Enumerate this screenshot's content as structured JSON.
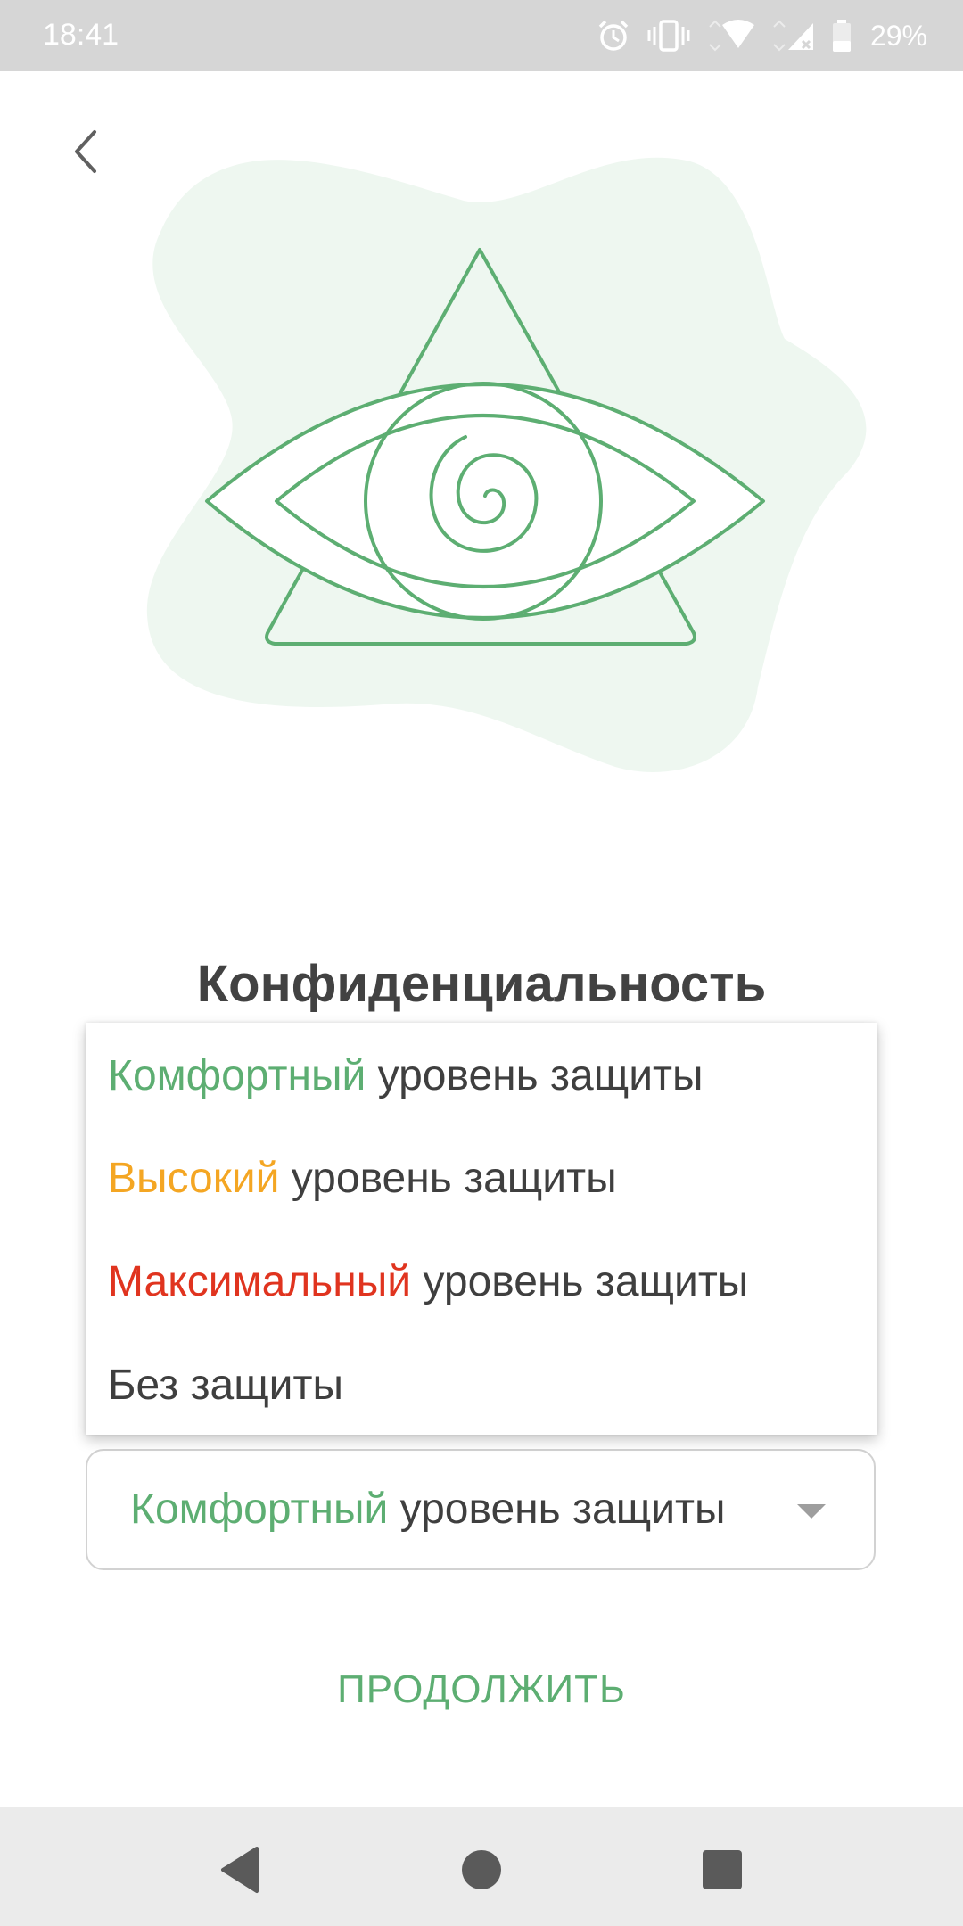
{
  "status_bar": {
    "time": "18:41",
    "battery": "29%",
    "icons": [
      "alarm-icon",
      "vibrate-icon",
      "wifi-icon",
      "cellular-icon",
      "battery-icon"
    ]
  },
  "header": {
    "back_icon": "chevron-left-icon"
  },
  "illustration": {
    "name": "eye-in-triangle-illustration"
  },
  "page": {
    "title": "Конфиденциальность"
  },
  "menu": {
    "items": [
      {
        "level": "Комфортный",
        "rest": " уровень защиты",
        "color": "#5dae72"
      },
      {
        "level": "Высокий",
        "rest": " уровень защиты",
        "color": "#f4a623"
      },
      {
        "level": "Максимальный",
        "rest": " уровень защиты",
        "color": "#e0341f"
      },
      {
        "level": "",
        "rest": "Без защиты",
        "color": "#3f3f3f"
      }
    ]
  },
  "dropdown": {
    "selected_level": "Комфортный",
    "selected_rest": " уровень защиты",
    "selected_color": "#5dae72"
  },
  "actions": {
    "continue_label": "ПРОДОЛЖИТЬ"
  },
  "nav": {
    "buttons": [
      "back-triangle-icon",
      "home-circle-icon",
      "recents-square-icon"
    ]
  },
  "colors": {
    "accent": "#5dae72",
    "blob": "#eef7f0",
    "text": "#3f3f3f"
  }
}
